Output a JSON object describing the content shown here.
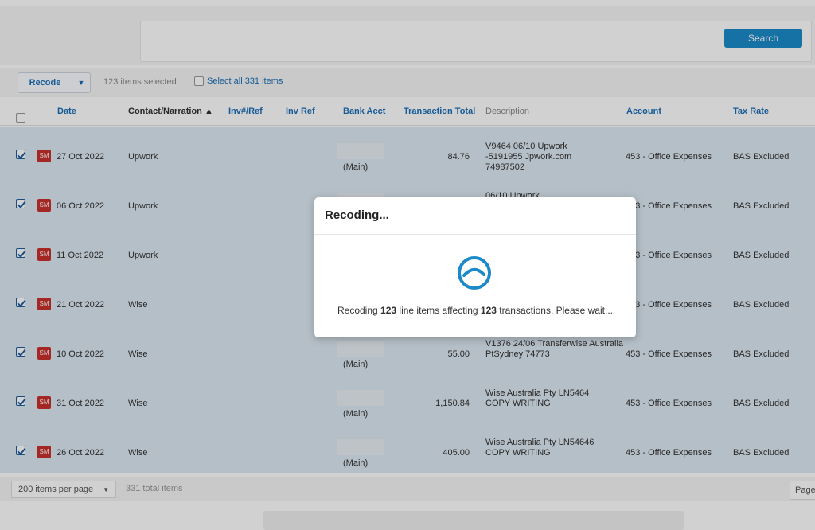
{
  "search": {
    "button_label": "Search"
  },
  "toolbar": {
    "recode_label": "Recode",
    "selected_text": "123 items selected",
    "select_all_label": "Select all 331 items"
  },
  "columns": {
    "date": "Date",
    "contact": "Contact/Narration ▲",
    "inv_ref_hash": "Inv#/Ref",
    "inv_ref": "Inv Ref",
    "bank_acct": "Bank Acct",
    "total": "Transaction Total",
    "description": "Description",
    "account": "Account",
    "tax_rate": "Tax Rate"
  },
  "rows": [
    {
      "badge": "SM",
      "date": "27 Oct 2022",
      "contact": "Upwork",
      "bank": "(Main)",
      "total": "84.76",
      "desc1": "V9464 06/10 Upwork",
      "desc2": "-5191955          Jpwork.com",
      "desc3": "74987502",
      "account": "453 - Office Expenses",
      "tax": "BAS Excluded"
    },
    {
      "badge": "SM",
      "date": "06 Oct 2022",
      "contact": "Upwork",
      "bank": "",
      "total": "",
      "desc1": "06/10 Upwork",
      "desc2": "",
      "desc3": "",
      "account": "453 - Office Expenses",
      "tax": "BAS Excluded"
    },
    {
      "badge": "SM",
      "date": "11 Oct 2022",
      "contact": "Upwork",
      "bank": "",
      "total": "",
      "desc1": "",
      "desc2": "",
      "desc3": "",
      "account": "453 - Office Expenses",
      "tax": "BAS Excluded"
    },
    {
      "badge": "SM",
      "date": "21 Oct 2022",
      "contact": "Wise",
      "bank": "",
      "total": "",
      "desc1": "",
      "desc2": "",
      "desc3": "",
      "account": "453 - Office Expenses",
      "tax": "BAS Excluded"
    },
    {
      "badge": "SM",
      "date": "10 Oct 2022",
      "contact": "Wise",
      "bank": "(Main)",
      "total": "55.00",
      "desc1": "V1376 24/06 Transferwise Australia",
      "desc2": "PtSydney 74773",
      "desc3": "",
      "account": "453 - Office Expenses",
      "tax": "BAS Excluded"
    },
    {
      "badge": "SM",
      "date": "31 Oct 2022",
      "contact": "Wise",
      "bank": "(Main)",
      "total": "1,150.84",
      "desc1": "Wise Australia Pty LN5464",
      "desc2": "COPY WRITING",
      "desc3": "",
      "account": "453 - Office Expenses",
      "tax": "BAS Excluded"
    },
    {
      "badge": "SM",
      "date": "26 Oct 2022",
      "contact": "Wise",
      "bank": "(Main)",
      "total": "405.00",
      "desc1": "Wise Australia Pty LN54646",
      "desc2": "COPY WRITING",
      "desc3": "",
      "account": "453 - Office Expenses",
      "tax": "BAS Excluded"
    }
  ],
  "footer": {
    "per_page": "200 items per page",
    "total_items": "331 total items",
    "page_label": "Page"
  },
  "modal": {
    "title": "Recoding...",
    "msg_prefix": "Recoding ",
    "line_items": "123",
    "msg_middle": " line items affecting ",
    "transactions": "123",
    "msg_suffix": " transactions. Please wait..."
  },
  "colors": {
    "accent": "#1c8ac9",
    "spinner": "#1c8ac9",
    "badge": "#c9302c"
  }
}
